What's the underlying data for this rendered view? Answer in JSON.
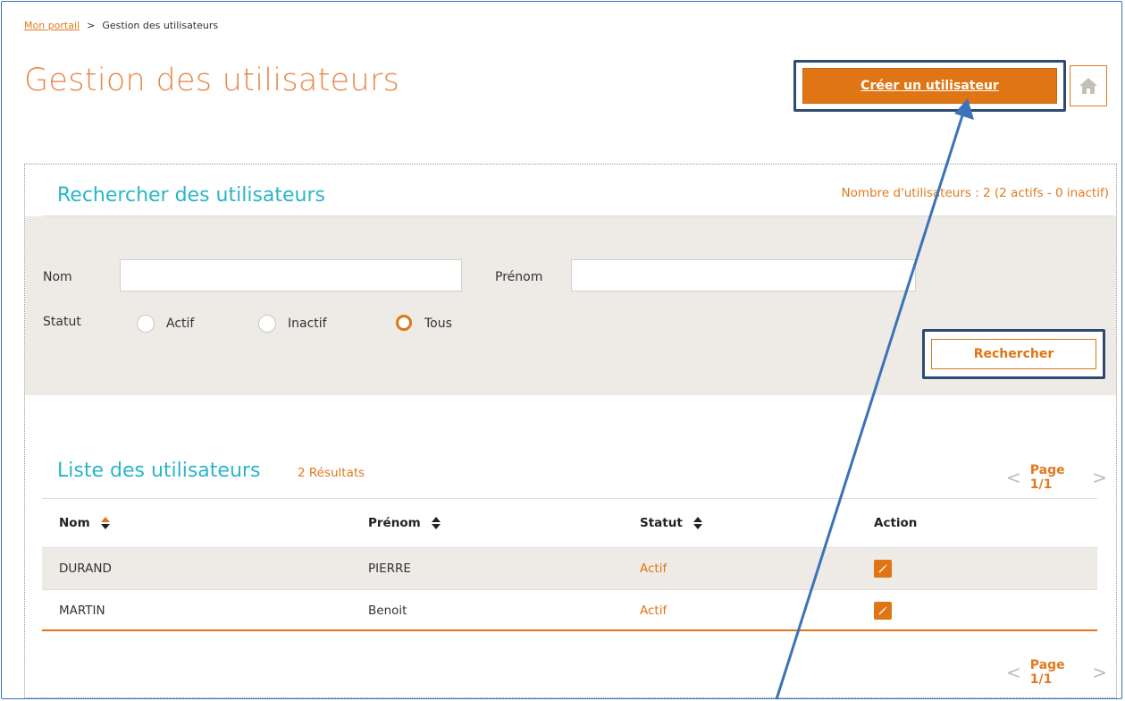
{
  "breadcrumb": {
    "home_link": "Mon portail",
    "separator": ">",
    "current": "Gestion des utilisateurs"
  },
  "page_title": "Gestion des utilisateurs",
  "actions": {
    "create_user": "Créer un utilisateur"
  },
  "search": {
    "title": "Rechercher des utilisateurs",
    "user_count": "Nombre d'utilisateurs : 2 (2 actifs - 0 inactif)",
    "nom_label": "Nom",
    "nom_value": "",
    "prenom_label": "Prénom",
    "prenom_value": "",
    "statut_label": "Statut",
    "statut_options": [
      "Actif",
      "Inactif",
      "Tous"
    ],
    "statut_selected": "Tous",
    "search_button": "Rechercher"
  },
  "list": {
    "title": "Liste des utilisateurs",
    "results": "2 Résultats",
    "page": "Page 1/1",
    "columns": [
      "Nom",
      "Prénom",
      "Statut",
      "Action"
    ],
    "rows": [
      {
        "nom": "DURAND",
        "prenom": "PIERRE",
        "statut": "Actif"
      },
      {
        "nom": "MARTIN",
        "prenom": "Benoit",
        "statut": "Actif"
      }
    ]
  },
  "icons": {
    "home": "home-icon",
    "edit": "pencil-icon",
    "prev": "chevron-left-icon",
    "next": "chevron-right-icon",
    "sort": "sort-icon"
  },
  "colors": {
    "accent": "#e07515",
    "title_teal": "#2bb5c9",
    "highlight_border": "#2e4a73",
    "annotation_arrow": "#3b73b9"
  }
}
